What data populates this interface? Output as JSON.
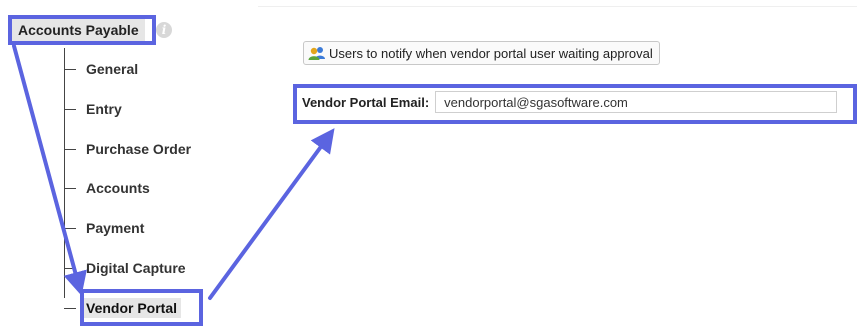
{
  "tree": {
    "root_label": "Accounts Payable",
    "items": [
      {
        "label": "General"
      },
      {
        "label": "Entry"
      },
      {
        "label": "Purchase Order"
      },
      {
        "label": "Accounts"
      },
      {
        "label": "Payment"
      },
      {
        "label": "Digital Capture"
      },
      {
        "label": "Vendor Portal",
        "selected": true
      }
    ]
  },
  "panel": {
    "notify_button_label": "Users to notify when vendor portal user waiting approval",
    "email_label": "Vendor Portal Email:",
    "email_value": "vendorportal@sgasoftware.com"
  },
  "icons": {
    "info": "info-icon",
    "users": "users-icon"
  },
  "colors": {
    "annotation": "#5b64e0",
    "selection_bg": "#e6e6e6"
  }
}
